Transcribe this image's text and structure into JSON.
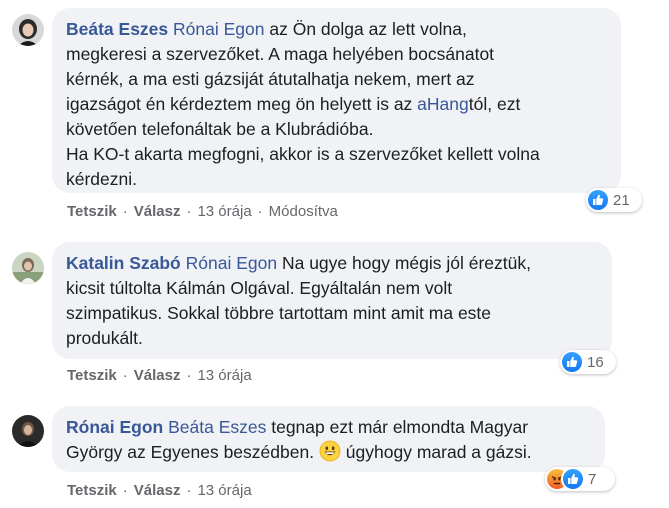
{
  "comments": [
    {
      "author": "Beáta Eszes",
      "mention": "Rónai Egon",
      "lines": [
        [
          {
            "t": "az Ön dolga az lett volna,"
          }
        ],
        [
          {
            "t": "megkeresi a szervezőket. A maga helyében bocsánatot"
          }
        ],
        [
          {
            "t": "kérnék, a ma esti gázsiját átutalhatja nekem, mert az"
          }
        ],
        [
          {
            "t": "igazságot én kérdeztem meg ön helyett is az "
          },
          {
            "t": "aHang",
            "link": true
          },
          {
            "t": "tól, ezt"
          }
        ],
        [
          {
            "t": "követően telefonáltak be a Klubrádióba."
          }
        ],
        [
          {
            "t": "Ha KO-t akarta megfogni, akkor is a szervezőket kellett volna"
          }
        ],
        [
          {
            "t": "kérdezni."
          }
        ]
      ],
      "actions": {
        "like": "Tetszik",
        "reply": "Válasz",
        "time": "13 órája",
        "edited": "Módosítva"
      },
      "reaction_count": "21"
    },
    {
      "author": "Katalin Szabó",
      "mention": "Rónai Egon",
      "lines": [
        [
          {
            "t": "Na ugye hogy mégis jól éreztük,"
          }
        ],
        [
          {
            "t": "kicsit túltolta Kálmán Olgával. Egyáltalán nem volt"
          }
        ],
        [
          {
            "t": "szimpatikus. Sokkal többre tartottam mint amit ma este"
          }
        ],
        [
          {
            "t": "produkált."
          }
        ]
      ],
      "actions": {
        "like": "Tetszik",
        "reply": "Válasz",
        "time": "13 órája"
      },
      "reaction_count": "16"
    },
    {
      "author": "Rónai Egon",
      "mention": "Beáta Eszes",
      "lines": [
        [
          {
            "t": "tegnap ezt már elmondta Magyar"
          }
        ],
        [
          {
            "t": "György az Egyenes beszédben. "
          },
          {
            "emoji": "grinning-face"
          },
          {
            "t": " úgyhogy marad a gázsi."
          }
        ]
      ],
      "actions": {
        "like": "Tetszik",
        "reply": "Válasz",
        "time": "13 órája"
      },
      "reaction_count": "7"
    }
  ],
  "colors": {
    "author": "#385898",
    "bubble": "#f0f2f5",
    "meta": "#65676b",
    "like": "#1877f2",
    "angry": "#f05a24"
  },
  "icons": {
    "like": "like-reaction-icon",
    "angry": "angry-reaction-icon",
    "separator": "·"
  }
}
